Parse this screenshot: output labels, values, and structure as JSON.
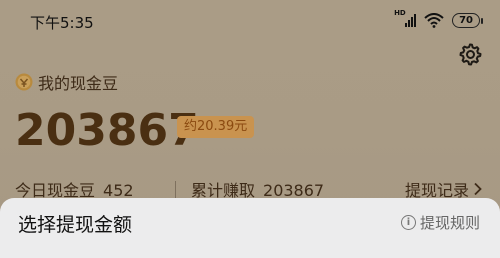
{
  "status_bar": {
    "time": "下午5:35",
    "network": "HD",
    "battery": "70",
    "icons": [
      "signal-icon",
      "wifi-icon",
      "battery-icon"
    ]
  },
  "header": {
    "settings_icon": "gear-icon"
  },
  "balance": {
    "title": "我的现金豆",
    "icon": "coin-icon",
    "amount": "203867",
    "approx_value": "约20.39元"
  },
  "stats": {
    "today_label": "今日现金豆",
    "today_value": "452",
    "total_label": "累计赚取",
    "total_value": "203867",
    "withdraw_records": "提现记录"
  },
  "sheet": {
    "title": "选择提现金额",
    "rules": "提现规则",
    "rules_icon": "info-icon"
  },
  "colors": {
    "amount": "#4a2f12",
    "badge_bg": "#c9934f",
    "badge_text": "#8b4a10",
    "sheet_bg": "#ececed"
  }
}
